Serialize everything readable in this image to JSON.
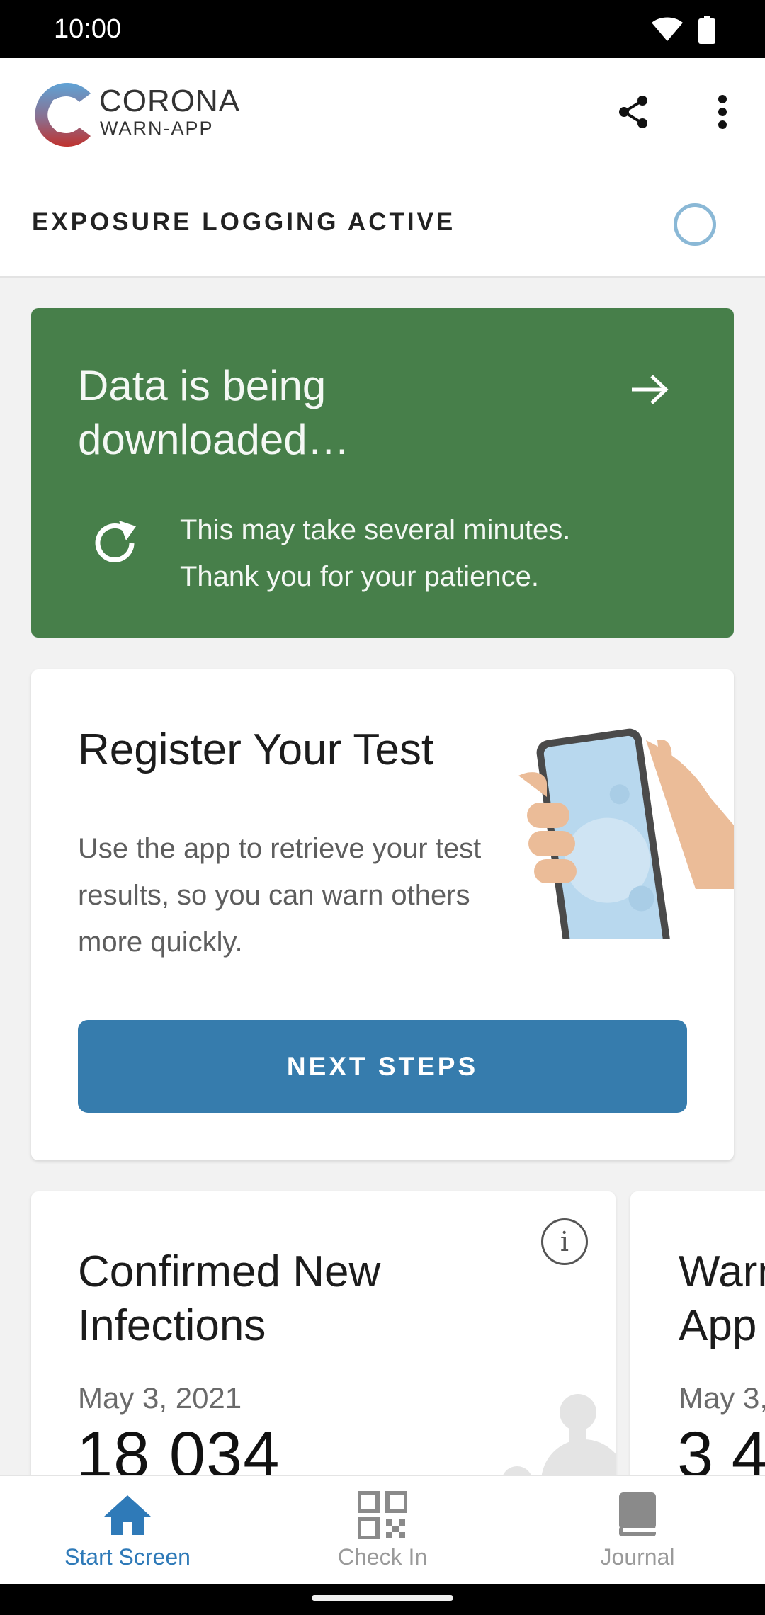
{
  "status_bar": {
    "time": "10:00"
  },
  "header": {
    "brand_title": "CORONA",
    "brand_subtitle": "WARN-APP",
    "exposure_label": "EXPOSURE LOGGING ACTIVE"
  },
  "risk_card": {
    "title": "Data is being downloaded…",
    "text_line1": "This may take several minutes.",
    "text_line2": "Thank you for your patience.",
    "background": "#477f4a"
  },
  "register_card": {
    "title": "Register Your Test",
    "text": "Use the app to retrieve your test results, so you can warn others more quickly.",
    "button_label": "NEXT STEPS",
    "button_color": "#367cad"
  },
  "stats": [
    {
      "title": "Confirmed New Infections",
      "date": "May 3, 2021",
      "value": "18 034"
    },
    {
      "title_line1": "Warn",
      "title_line2": "App",
      "date": "May 3,",
      "value": "3 4"
    }
  ],
  "bottom_nav": {
    "items": [
      {
        "label": "Start Screen",
        "icon": "home-icon",
        "active": true
      },
      {
        "label": "Check In",
        "icon": "qr-code-icon",
        "active": false
      },
      {
        "label": "Journal",
        "icon": "book-icon",
        "active": false
      }
    ],
    "active_color": "#2f7ab8"
  }
}
